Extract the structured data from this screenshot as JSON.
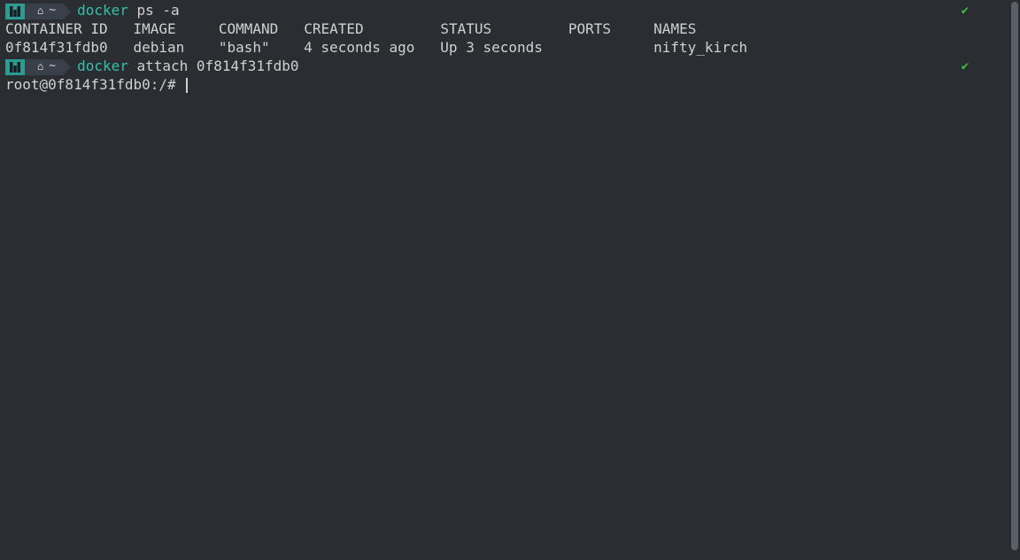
{
  "prompt1": {
    "logo": "manjaro-icon",
    "home_glyph": "⌂",
    "tilde": "~",
    "command_name": "docker",
    "command_args": " ps -a",
    "success_glyph": "✔"
  },
  "table": {
    "headers": {
      "container_id": "CONTAINER ID",
      "image": "IMAGE",
      "command": "COMMAND",
      "created": "CREATED",
      "status": "STATUS",
      "ports": "PORTS",
      "names": "NAMES"
    },
    "rows": [
      {
        "container_id": "0f814f31fdb0",
        "image": "debian",
        "command": "\"bash\"",
        "created": "4 seconds ago",
        "status": "Up 3 seconds",
        "ports": "",
        "names": "nifty_kirch"
      }
    ]
  },
  "prompt2": {
    "logo": "manjaro-icon",
    "home_glyph": "⌂",
    "tilde": "~",
    "command_name": "docker",
    "command_args": " attach 0f814f31fdb0",
    "success_glyph": "✔"
  },
  "root_prompt": "root@0f814f31fdb0:/# "
}
